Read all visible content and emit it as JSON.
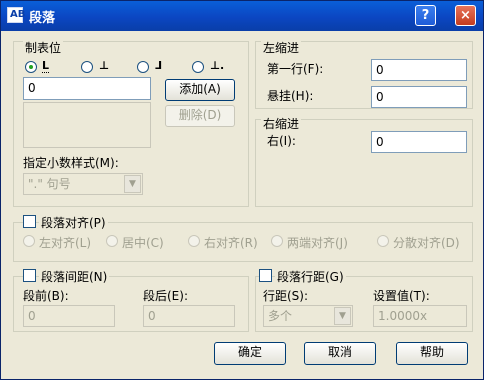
{
  "window": {
    "title": "段落",
    "icon_text": "AB",
    "help_label": "?",
    "close_label": "×"
  },
  "tabstops": {
    "title": "制表位",
    "options": [
      {
        "glyph": "L",
        "state": "selected",
        "icon": "left-tab-icon"
      },
      {
        "glyph": "⊥",
        "state": "unselected",
        "icon": "center-tab-icon"
      },
      {
        "glyph": "⅃",
        "state": "unselected",
        "icon": "right-tab-icon"
      },
      {
        "glyph": "⊥.",
        "state": "unselected",
        "icon": "decimal-tab-icon"
      }
    ],
    "input_value": "0",
    "add_label": "添加(A)",
    "delete_label": "删除(D)",
    "decimal_style_label": "指定小数样式(M):",
    "decimal_style_value": "\".\" 句号"
  },
  "left_indent": {
    "title": "左缩进",
    "first_line_label": "第一行(F):",
    "first_line_value": "0",
    "hanging_label": "悬挂(H):",
    "hanging_value": "0"
  },
  "right_indent": {
    "title": "右缩进",
    "right_label": "右(I):",
    "right_value": "0"
  },
  "alignment": {
    "title": "段落对齐(P)",
    "options": [
      "左对齐(L)",
      "居中(C)",
      "右对齐(R)",
      "两端对齐(J)",
      "分散对齐(D)"
    ]
  },
  "spacing": {
    "title": "段落间距(N)",
    "before_label": "段前(B):",
    "before_value": "0",
    "after_label": "段后(E):",
    "after_value": "0"
  },
  "line_spacing": {
    "title": "段落行距(G)",
    "line_label": "行距(S):",
    "line_value": "多个",
    "value_label": "设置值(T):",
    "value_value": "1.0000x"
  },
  "buttons": {
    "ok": "确定",
    "cancel": "取消",
    "help": "帮助"
  }
}
